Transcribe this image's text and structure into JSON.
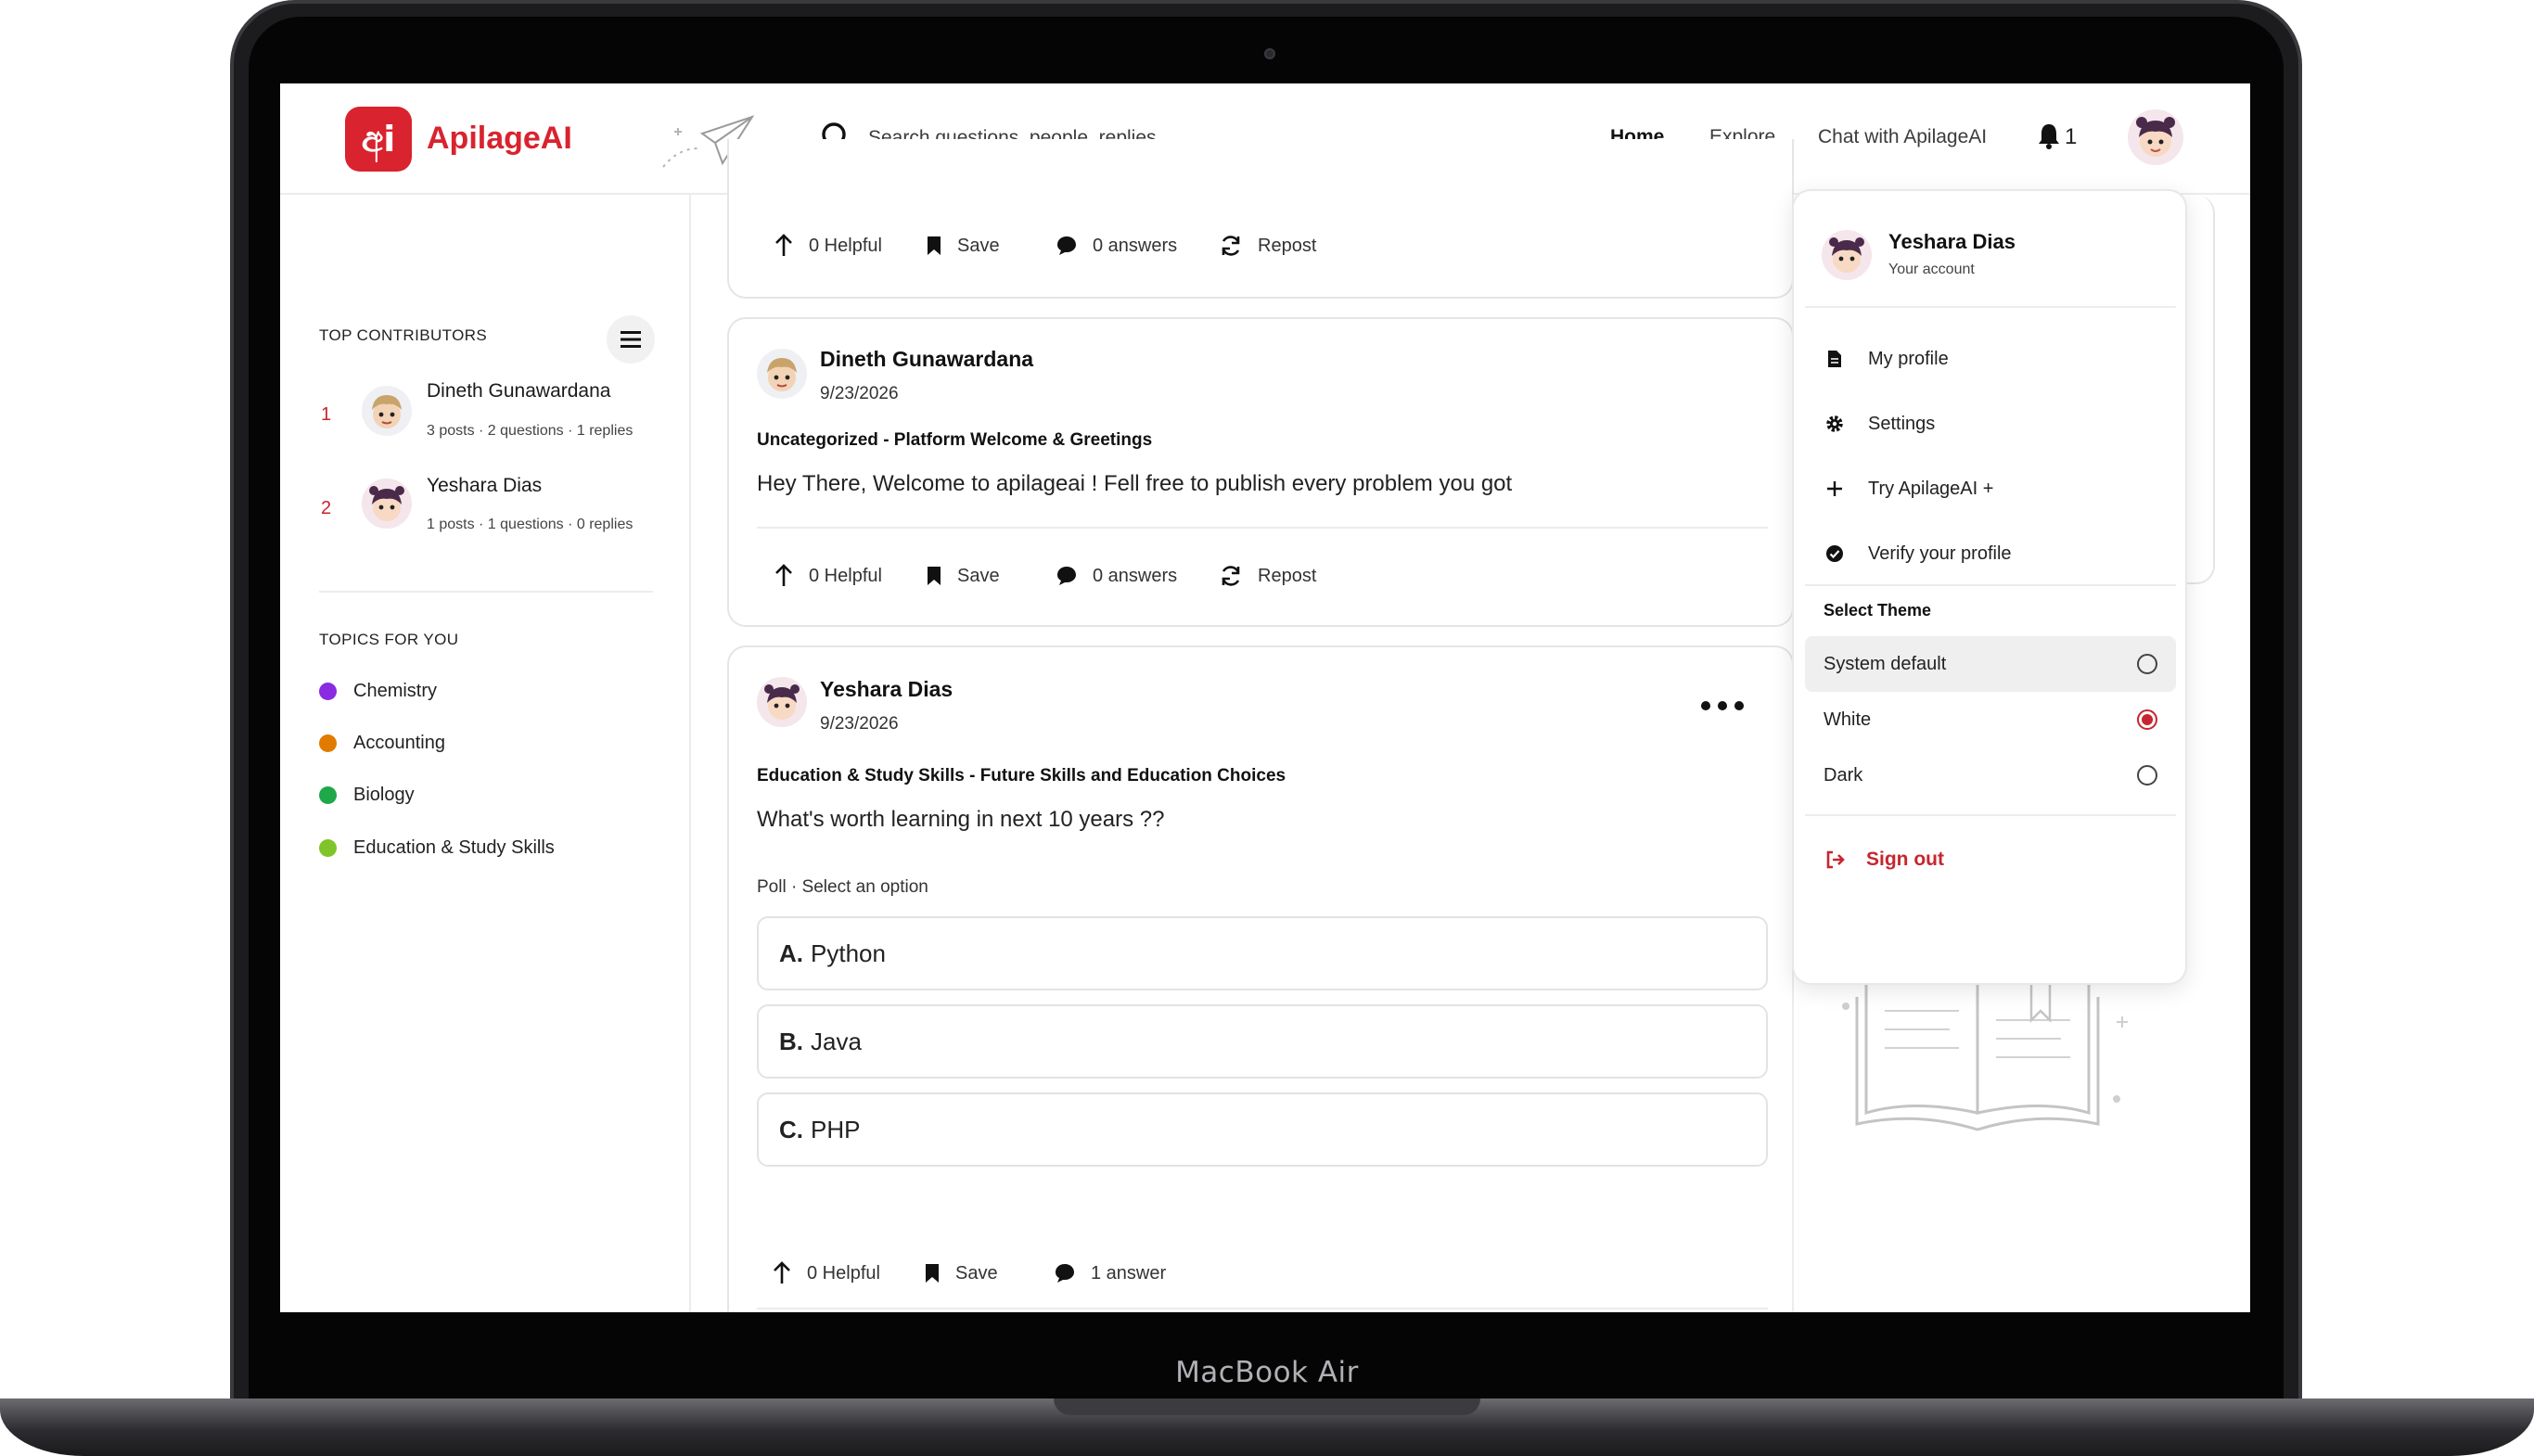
{
  "device": {
    "label": "MacBook Air"
  },
  "brand": {
    "name": "ApilageAI",
    "mark": "අi",
    "color": "#d9232e"
  },
  "search": {
    "placeholder": "Search questions, people, replies..."
  },
  "nav": {
    "home": "Home",
    "explore": "Explore",
    "chat": "Chat with ApilageAI"
  },
  "notifications": {
    "count": "1"
  },
  "sidebar": {
    "top_contributors_title": "TOP CONTRIBUTORS",
    "contributors": [
      {
        "rank": "1",
        "name": "Dineth Gunawardana",
        "stats": "3 posts · 2 questions · 1 replies"
      },
      {
        "rank": "2",
        "name": "Yeshara Dias",
        "stats": "1 posts · 1 questions · 0 replies"
      }
    ],
    "topics_title": "TOPICS FOR YOU",
    "topics": [
      {
        "label": "Chemistry",
        "color": "#8a2be2"
      },
      {
        "label": "Accounting",
        "color": "#e07b00"
      },
      {
        "label": "Biology",
        "color": "#1ea84a"
      },
      {
        "label": "Education & Study Skills",
        "color": "#7fc42b"
      }
    ]
  },
  "actions": {
    "helpful": "0 Helpful",
    "save": "Save",
    "zero_answers": "0 answers",
    "one_answer": "1 answer",
    "repost": "Repost"
  },
  "posts": [
    {
      "author": "Dineth Gunawardana",
      "date": "9/23/2026",
      "category": "Uncategorized - Platform Welcome & Greetings",
      "body": "Hey There, Welcome to apilageai ! Fell free to publish every problem you got"
    },
    {
      "author": "Yeshara Dias",
      "date": "9/23/2026",
      "category": "Education & Study Skills - Future Skills and Education Choices",
      "body": "What's worth learning in next 10 years ??",
      "poll_label": "Poll · Select an option",
      "options": [
        {
          "letter": "A.",
          "text": "Python"
        },
        {
          "letter": "B.",
          "text": "Java"
        },
        {
          "letter": "C.",
          "text": "PHP"
        }
      ]
    }
  ],
  "account_menu": {
    "name": "Yeshara Dias",
    "subtitle": "Your account",
    "items": {
      "profile": "My profile",
      "settings": "Settings",
      "try_plus": "Try ApilageAI +",
      "verify": "Verify your profile"
    },
    "theme_title": "Select Theme",
    "themes": [
      {
        "label": "System default",
        "selected": false
      },
      {
        "label": "White",
        "selected": true
      },
      {
        "label": "Dark",
        "selected": false
      }
    ],
    "sign_out": "Sign out"
  }
}
